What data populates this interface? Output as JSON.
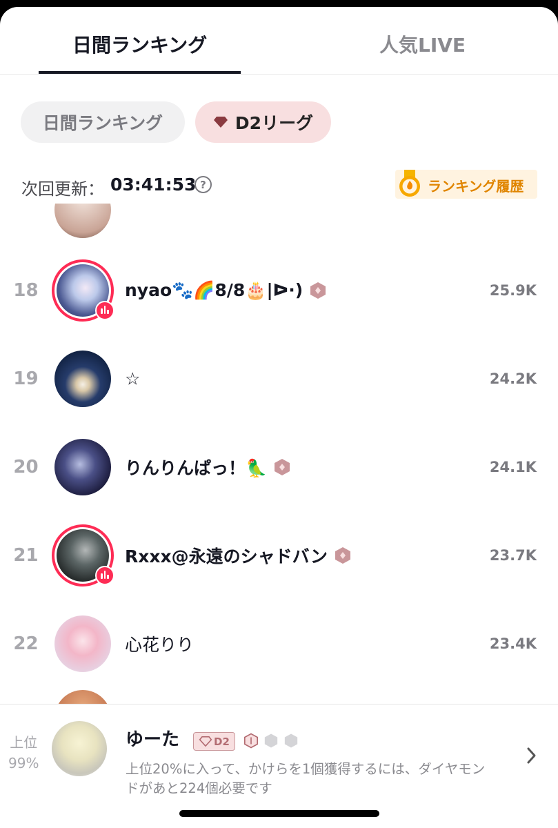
{
  "tabs": [
    {
      "label": "日間ランキング",
      "active": true
    },
    {
      "label": "人気LIVE",
      "active": false
    }
  ],
  "filters": {
    "daily_label": "日間ランキング",
    "league_label": "D2リーグ",
    "league_gem_icon": "diamond-icon"
  },
  "refresh": {
    "label": "次回更新：",
    "time": "03:41:53",
    "help_icon": "?"
  },
  "history_button": {
    "label": "ランキング履歴",
    "icon": "medal-icon"
  },
  "rows": [
    {
      "rank": "18",
      "name": "nyao🐾🌈8/8🎂|ᐅ·)",
      "score": "25.9K",
      "live": true,
      "badge": true
    },
    {
      "rank": "19",
      "name": "☆",
      "score": "24.2K",
      "live": false,
      "badge": false
    },
    {
      "rank": "20",
      "name": "りんりんぱっ！🦜",
      "score": "24.1K",
      "live": false,
      "badge": true
    },
    {
      "rank": "21",
      "name": "Rxxx@永遠のシャドバン",
      "score": "23.7K",
      "live": true,
      "badge": true
    },
    {
      "rank": "22",
      "name": "心花りり",
      "score": "23.4K",
      "live": false,
      "badge": false
    }
  ],
  "me": {
    "rank_label": "上位",
    "rank_value": "99%",
    "name": "ゆーた",
    "league_tag": "D2",
    "description": "上位20%に入って、かけらを1個獲得するには、ダイヤモンドがあと224個必要です"
  },
  "colors": {
    "live_red": "#fe2c55",
    "league_pink": "#f8dfe0",
    "gem": "#8a3a40",
    "history_orange": "#e08500",
    "badge_hex": "#c9969a"
  }
}
